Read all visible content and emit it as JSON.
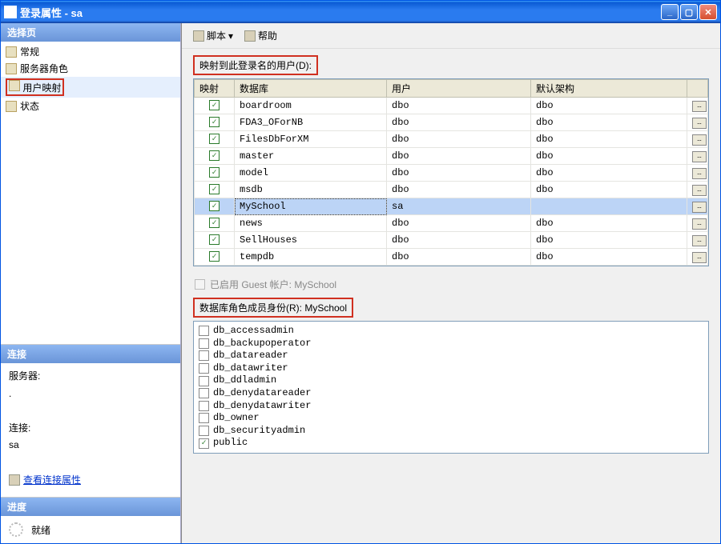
{
  "window": {
    "title": "登录属性 - sa"
  },
  "sidebar": {
    "select_page_header": "选择页",
    "items": [
      {
        "label": "常规"
      },
      {
        "label": "服务器角色"
      },
      {
        "label": "用户映射"
      },
      {
        "label": "状态"
      }
    ],
    "selected_index": 2,
    "connection_header": "连接",
    "server_label": "服务器:",
    "server_value": ".",
    "conn_label": "连接:",
    "conn_value": "sa",
    "view_conn_props": "查看连接属性",
    "progress_header": "进度",
    "progress_status": "就绪"
  },
  "toolbar": {
    "script_label": "脚本",
    "help_label": "帮助"
  },
  "mapping": {
    "section_label": "映射到此登录名的用户(D):",
    "columns": {
      "map": "映射",
      "db": "数据库",
      "user": "用户",
      "schema": "默认架构"
    },
    "rows": [
      {
        "checked": true,
        "db": "boardroom",
        "user": "dbo",
        "schema": "dbo"
      },
      {
        "checked": true,
        "db": "FDA3_OForNB",
        "user": "dbo",
        "schema": "dbo"
      },
      {
        "checked": true,
        "db": "FilesDbForXM",
        "user": "dbo",
        "schema": "dbo"
      },
      {
        "checked": true,
        "db": "master",
        "user": "dbo",
        "schema": "dbo"
      },
      {
        "checked": true,
        "db": "model",
        "user": "dbo",
        "schema": "dbo"
      },
      {
        "checked": true,
        "db": "msdb",
        "user": "dbo",
        "schema": "dbo"
      },
      {
        "checked": true,
        "db": "MySchool",
        "user": "sa",
        "schema": "",
        "selected": true
      },
      {
        "checked": true,
        "db": "news",
        "user": "dbo",
        "schema": "dbo"
      },
      {
        "checked": true,
        "db": "SellHouses",
        "user": "dbo",
        "schema": "dbo"
      },
      {
        "checked": true,
        "db": "tempdb",
        "user": "dbo",
        "schema": "dbo"
      }
    ]
  },
  "guest": {
    "label": "已启用 Guest 帐户: MySchool"
  },
  "roles": {
    "section_label": "数据库角色成员身份(R): MySchool",
    "items": [
      {
        "name": "db_accessadmin",
        "checked": false
      },
      {
        "name": "db_backupoperator",
        "checked": false
      },
      {
        "name": "db_datareader",
        "checked": false
      },
      {
        "name": "db_datawriter",
        "checked": false
      },
      {
        "name": "db_ddladmin",
        "checked": false
      },
      {
        "name": "db_denydatareader",
        "checked": false
      },
      {
        "name": "db_denydatawriter",
        "checked": false
      },
      {
        "name": "db_owner",
        "checked": false
      },
      {
        "name": "db_securityadmin",
        "checked": false
      },
      {
        "name": "public",
        "checked": true
      }
    ]
  }
}
